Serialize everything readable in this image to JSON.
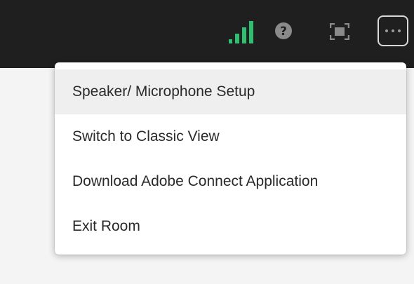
{
  "toolbar": {
    "icons": [
      "signal-strength-icon",
      "help-icon",
      "fullscreen-icon",
      "more-options-icon"
    ],
    "signal_color": "#2fbf71",
    "icon_color": "#8a8a8a"
  },
  "menu": {
    "items": [
      {
        "label": "Speaker/ Microphone Setup",
        "highlighted": true
      },
      {
        "label": "Switch to Classic View",
        "highlighted": false
      },
      {
        "label": "Download Adobe Connect Application",
        "highlighted": false
      },
      {
        "label": "Exit Room",
        "highlighted": false
      }
    ]
  }
}
